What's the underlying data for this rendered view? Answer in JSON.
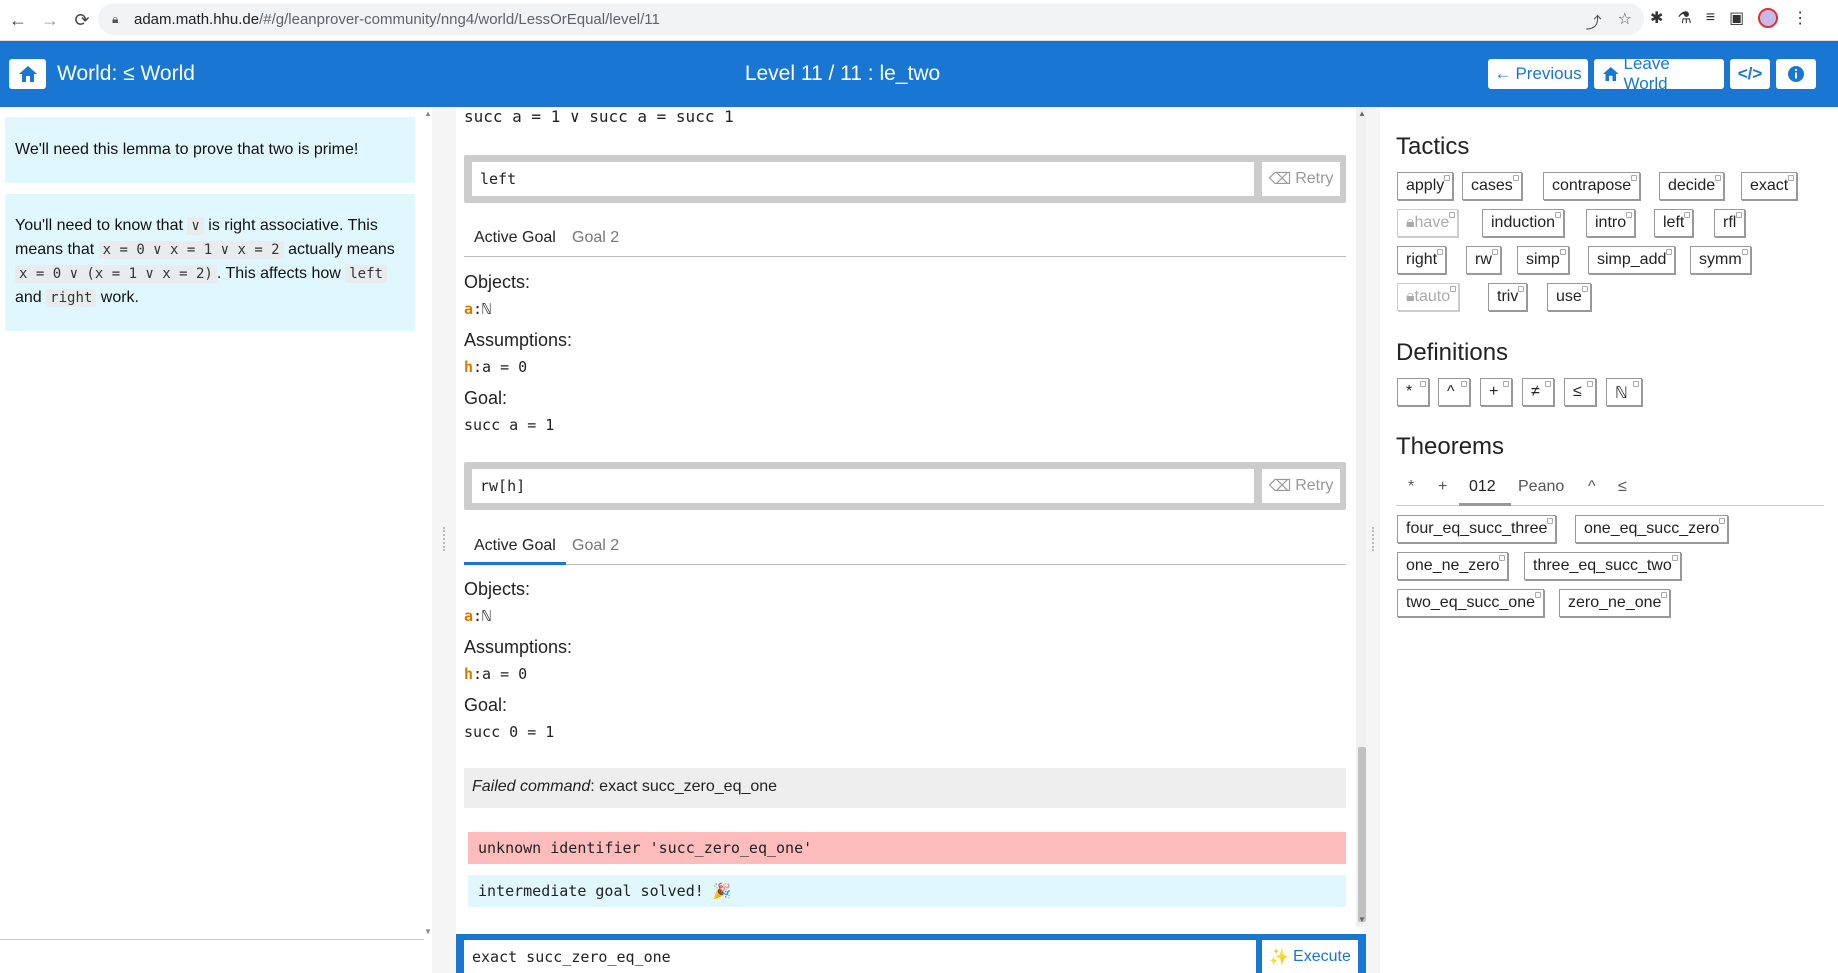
{
  "browser": {
    "url_host": "adam.math.hhu.de",
    "url_path": "/#/g/leanprover-community/nng4/world/LessOrEqual/level/11"
  },
  "header": {
    "world_title": "World: ≤ World",
    "level_title": "Level 11 / 11 : le_two",
    "previous_label": "Previous",
    "leave_label": "Leave World"
  },
  "left": {
    "msg1": "We'll need this lemma to prove that two is prime!",
    "msg2": {
      "p1": "You'll need to know that",
      "c1": "∨",
      "p2": "is right associative. This means that",
      "c2": "x = 0 ∨ x = 1 ∨ x = 2",
      "p3": "actually means",
      "c3": "x = 0 ∨ (x = 1 ∨ x = 2)",
      "p4": ". This affects how",
      "c4": "left",
      "p5": "and",
      "c5": "right",
      "p6": "work."
    }
  },
  "center": {
    "top_line": "succ a = 1 ∨ succ a = succ 1",
    "step1": {
      "command": "left",
      "retry": "Retry",
      "tab_active": "Active Goal",
      "tab_other": "Goal 2",
      "objects_label": "Objects:",
      "obj_name": "a",
      "obj_type": ":ℕ",
      "assumptions_label": "Assumptions:",
      "hyp_name": "h",
      "hyp_type": ":a = 0",
      "goal_label": "Goal:",
      "goal": "succ a = 1"
    },
    "step2": {
      "command": "rw[h]",
      "retry": "Retry",
      "tab_active": "Active Goal",
      "tab_other": "Goal 2",
      "objects_label": "Objects:",
      "obj_name": "a",
      "obj_type": ":ℕ",
      "assumptions_label": "Assumptions:",
      "hyp_name": "h",
      "hyp_type": ":a = 0",
      "goal_label": "Goal:",
      "goal": "succ 0 = 1"
    },
    "failed_label": "Failed command",
    "failed_cmd": ": exact succ_zero_eq_one",
    "error": "unknown identifier 'succ_zero_eq_one'",
    "info": "intermediate goal solved! 🎉",
    "input_value": "exact succ_zero_eq_one",
    "execute_label": "Execute"
  },
  "right": {
    "tactics_title": "Tactics",
    "tactics": [
      "apply",
      "cases",
      "contrapose",
      "decide",
      "exact",
      "have",
      "induction",
      "intro",
      "left",
      "rfl",
      "right",
      "rw",
      "simp",
      "simp_add",
      "symm",
      "tauto",
      "triv",
      "use"
    ],
    "definitions_title": "Definitions",
    "definitions": [
      "*",
      "^",
      "+",
      "≠",
      "≤",
      "ℕ"
    ],
    "theorems_title": "Theorems",
    "theorem_tabs": [
      "*",
      "+",
      "012",
      "Peano",
      "^",
      "≤"
    ],
    "theorems": [
      "four_eq_succ_three",
      "one_eq_succ_zero",
      "one_ne_zero",
      "three_eq_succ_two",
      "two_eq_succ_one",
      "zero_ne_one"
    ]
  }
}
